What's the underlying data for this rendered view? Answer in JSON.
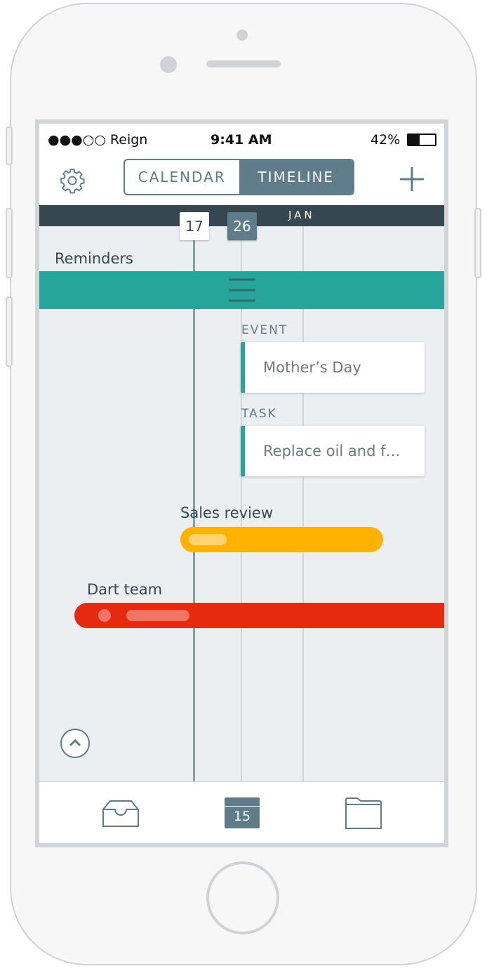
{
  "status": {
    "carrier": "●●●○○ Reign",
    "time": "9:41 AM",
    "battery": "42%"
  },
  "header": {
    "tabs": [
      {
        "label": "CALENDAR",
        "active": false
      },
      {
        "label": "TIMELINE",
        "active": true
      }
    ]
  },
  "timeline": {
    "month": "JAN",
    "today": "17",
    "selected": "26",
    "reminders_label": "Reminders",
    "event_caption": "EVENT",
    "event_title": "Mother’s Day",
    "task_caption": "TASK",
    "task_title": "Replace oil and f…",
    "bars": [
      {
        "label": "Sales review",
        "color": "#ffb300"
      },
      {
        "label": "Dart team",
        "color": "#e62a10"
      }
    ]
  },
  "tabbar": {
    "calendar_day": "15"
  },
  "colors": {
    "accent": "#26a69a",
    "primary": "#5f7c8a",
    "dark": "#37474f"
  }
}
